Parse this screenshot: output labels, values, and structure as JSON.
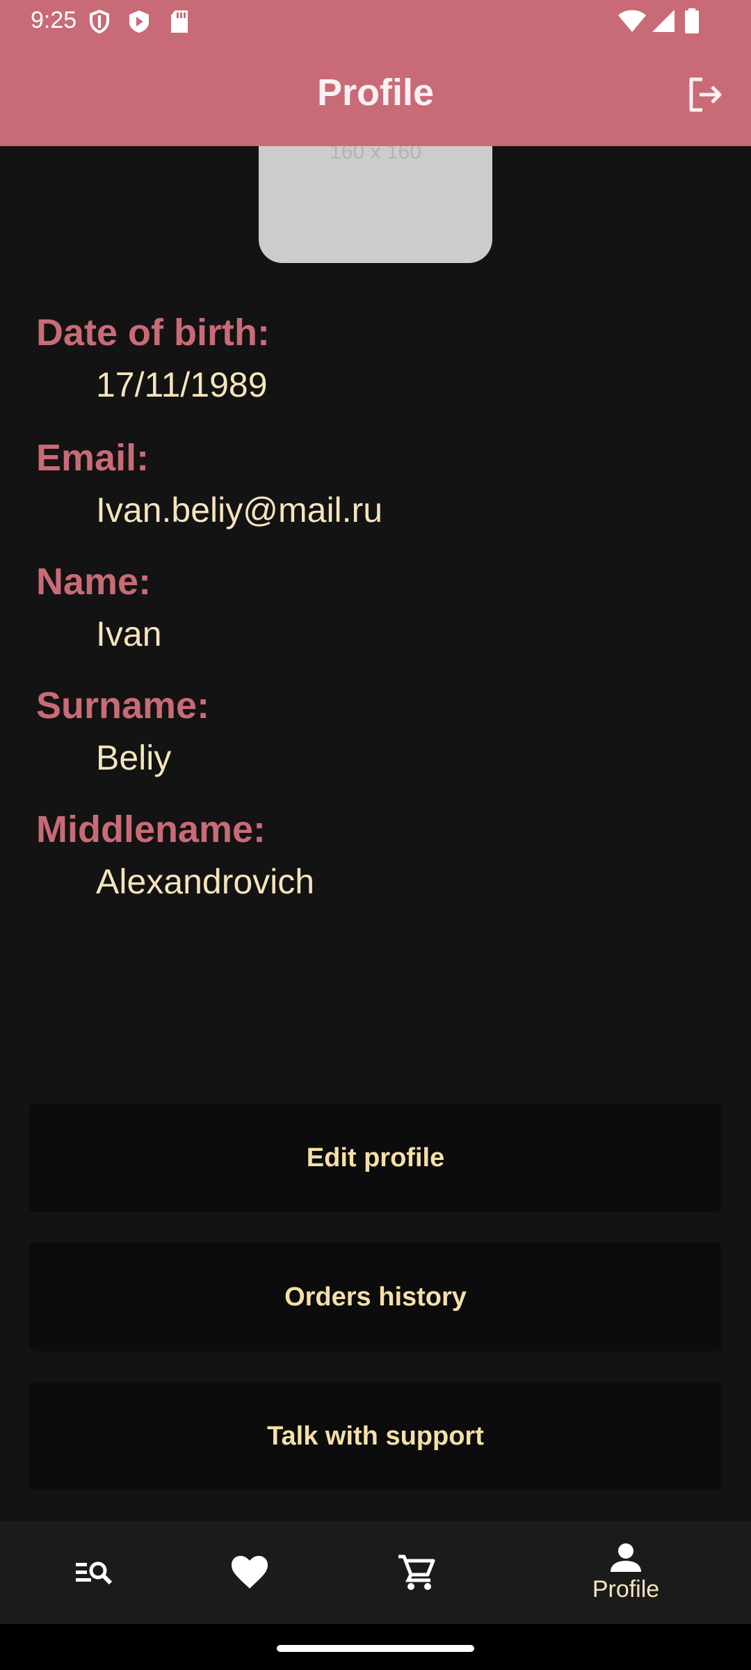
{
  "status_bar": {
    "time": "9:25",
    "left_icons": [
      "shield-icon",
      "play-icon",
      "sd-card-icon"
    ],
    "right_icons": [
      "wifi-icon",
      "signal-icon",
      "battery-icon"
    ]
  },
  "app_bar": {
    "title": "Profile",
    "action_icon": "logout-icon",
    "background": "#c96b77"
  },
  "avatar": {
    "caption": "160 x 160"
  },
  "fields": [
    {
      "label": "Date of birth:",
      "value": "17/11/1989"
    },
    {
      "label": "Email:",
      "value": "Ivan.beliy@mail.ru"
    },
    {
      "label": "Name:",
      "value": "Ivan"
    },
    {
      "label": "Surname:",
      "value": "Beliy"
    },
    {
      "label": "Middlename:",
      "value": "Alexandrovich"
    }
  ],
  "actions": {
    "edit_profile": "Edit profile",
    "orders_history": "Orders history",
    "talk_with_support": "Talk with support"
  },
  "bottom_nav": {
    "items": [
      {
        "icon": "search-list-icon",
        "label": ""
      },
      {
        "icon": "heart-icon",
        "label": ""
      },
      {
        "icon": "cart-icon",
        "label": ""
      },
      {
        "icon": "person-icon",
        "label": "Profile",
        "selected": true
      }
    ]
  },
  "colors": {
    "accent": "#c96b77",
    "value_text": "#f6e4bc",
    "background": "#131313"
  }
}
